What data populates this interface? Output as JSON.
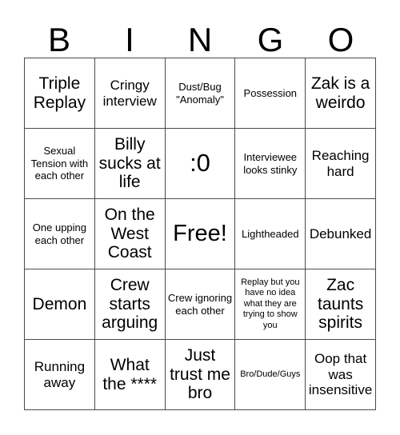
{
  "card": {
    "header_letters": [
      "B",
      "I",
      "N",
      "G",
      "O"
    ],
    "rows": [
      [
        {
          "text": "Triple Replay",
          "size": "fs-lg"
        },
        {
          "text": "Cringy interview",
          "size": "fs-md"
        },
        {
          "text": "Dust/Bug \"Anomaly\"",
          "size": "fs-sm"
        },
        {
          "text": "Possession",
          "size": "fs-sm"
        },
        {
          "text": "Zak is a weirdo",
          "size": "fs-lg"
        }
      ],
      [
        {
          "text": "Sexual Tension with each other",
          "size": "fs-sm"
        },
        {
          "text": "Billy sucks at life",
          "size": "fs-lg"
        },
        {
          "text": ":0",
          "size": "fs-xl"
        },
        {
          "text": "Interviewee looks stinky",
          "size": "fs-sm"
        },
        {
          "text": "Reaching hard",
          "size": "fs-md"
        }
      ],
      [
        {
          "text": "One upping each other",
          "size": "fs-sm"
        },
        {
          "text": "On the West Coast",
          "size": "fs-lg"
        },
        {
          "text": "Free!",
          "size": "fs-free"
        },
        {
          "text": "Lightheaded",
          "size": "fs-sm"
        },
        {
          "text": "Debunked",
          "size": "fs-md"
        }
      ],
      [
        {
          "text": "Demon",
          "size": "fs-lg"
        },
        {
          "text": "Crew starts arguing",
          "size": "fs-lg"
        },
        {
          "text": "Crew ignoring each other",
          "size": "fs-sm"
        },
        {
          "text": "Replay but you have no idea what they are trying to show you",
          "size": "fs-xs"
        },
        {
          "text": "Zac taunts spirits",
          "size": "fs-lg"
        }
      ],
      [
        {
          "text": "Running away",
          "size": "fs-md"
        },
        {
          "text": "What the ****",
          "size": "fs-lg"
        },
        {
          "text": "Just trust me bro",
          "size": "fs-lg"
        },
        {
          "text": "Bro/Dude/Guys",
          "size": "fs-xs"
        },
        {
          "text": "Oop that was insensitive",
          "size": "fs-md"
        }
      ]
    ]
  },
  "colors": {
    "background": "#ffffff",
    "text": "#000000",
    "grid_line": "#4a4a4a"
  }
}
